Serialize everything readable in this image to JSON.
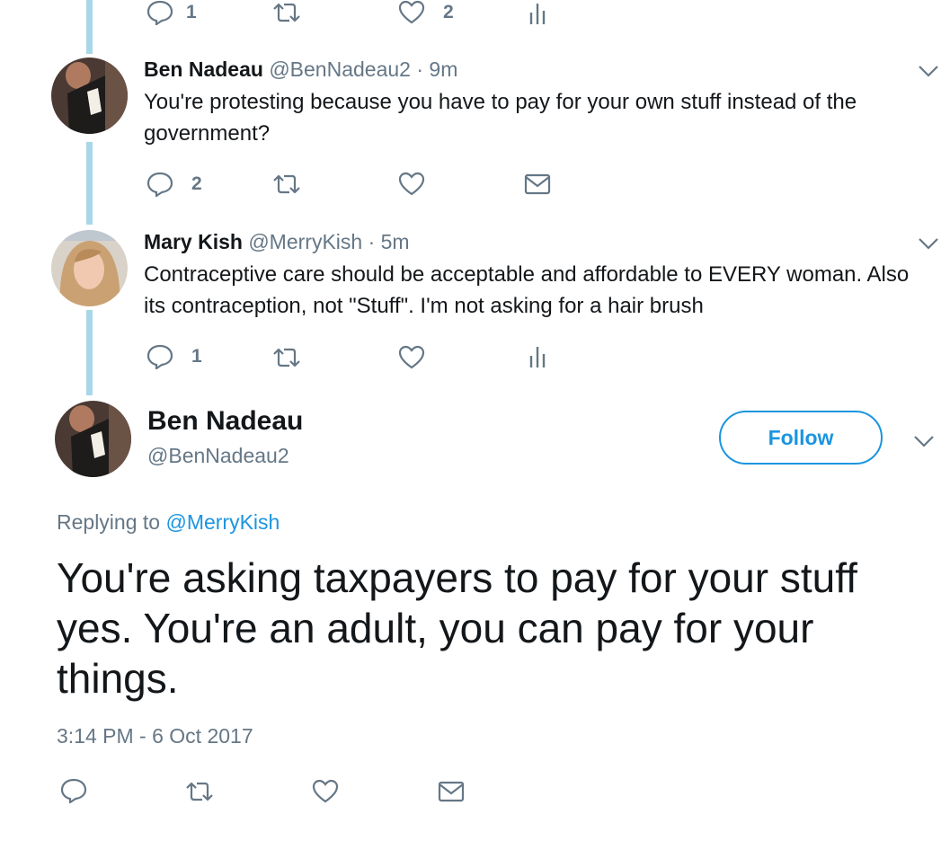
{
  "top_actions": {
    "reply_count": "1",
    "like_count": "2"
  },
  "tweet1": {
    "name": "Ben Nadeau",
    "handle": "@BenNadeau2",
    "time": "· 9m",
    "text": "You're protesting because you have to pay for your own stuff instead of the government?",
    "reply_count": "2"
  },
  "tweet2": {
    "name": "Mary Kish",
    "handle": "@MerryKish",
    "time": "· 5m",
    "text": "Contraceptive care should be acceptable and affordable to EVERY woman.  Also its contraception, not \"Stuff\". I'm not asking for a hair brush",
    "reply_count": "1"
  },
  "main": {
    "name": "Ben Nadeau",
    "handle": "@BenNadeau2",
    "follow_label": "Follow",
    "replying_prefix": "Replying to",
    "replying_to": "@MerryKish",
    "text": "You're asking taxpayers to pay for your stuff yes. You're an adult, you can pay for your things.",
    "timestamp": "3:14 PM - 6 Oct 2017"
  },
  "colors": {
    "accent": "#1b95e0",
    "thread_line": "#a9d7ea",
    "muted": "#657786"
  },
  "icons": [
    "reply-icon",
    "retweet-icon",
    "like-icon",
    "analytics-icon",
    "dm-icon",
    "chevron-down-icon"
  ]
}
